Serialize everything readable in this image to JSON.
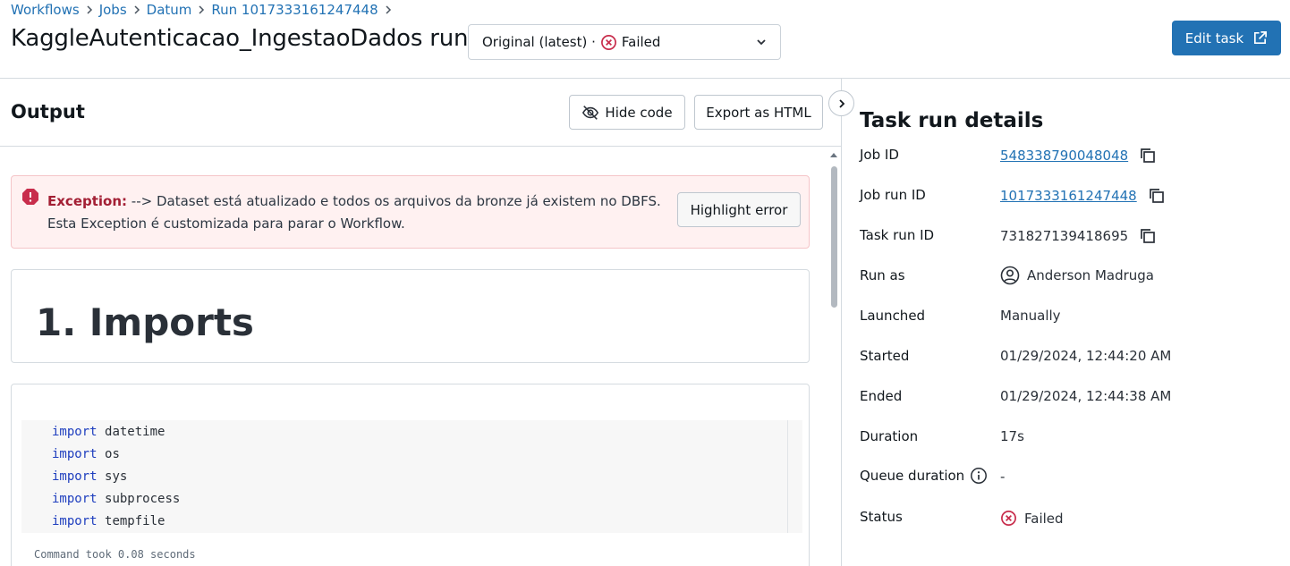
{
  "breadcrumb": {
    "items": [
      "Workflows",
      "Jobs",
      "Datum",
      "Run 1017333161247448"
    ]
  },
  "page_title": "KaggleAutenticacao_IngestaoDados run",
  "run_selector": {
    "selected": "Original (latest) ·",
    "status": "Failed"
  },
  "edit_task_label": "Edit task",
  "output": {
    "title": "Output",
    "hide_code_label": "Hide code",
    "export_label": "Export as HTML",
    "error": {
      "label": "Exception:",
      "message": " --> Dataset está atualizado e todos os arquivos da bronze já existem no DBFS. Esta Exception é customizada para parar o Workflow.",
      "highlight_label": "Highlight error"
    },
    "markdown_heading": "1. Imports",
    "code": {
      "keyword": "import",
      "modules": [
        "datetime",
        "os",
        "sys",
        "subprocess",
        "tempfile"
      ]
    },
    "command_took": "Command took 0.08 seconds"
  },
  "details": {
    "title": "Task run details",
    "job_id": {
      "label": "Job ID",
      "value": "548338790048048"
    },
    "job_run_id": {
      "label": "Job run ID",
      "value": "1017333161247448"
    },
    "task_run_id": {
      "label": "Task run ID",
      "value": "731827139418695"
    },
    "run_as": {
      "label": "Run as",
      "value": "Anderson Madruga"
    },
    "launched": {
      "label": "Launched",
      "value": "Manually"
    },
    "started": {
      "label": "Started",
      "value": "01/29/2024, 12:44:20 AM"
    },
    "ended": {
      "label": "Ended",
      "value": "01/29/2024, 12:44:38 AM"
    },
    "duration": {
      "label": "Duration",
      "value": "17s"
    },
    "queue_duration": {
      "label": "Queue duration",
      "value": "-"
    },
    "status": {
      "label": "Status",
      "value": "Failed"
    }
  },
  "colors": {
    "primary": "#2272b4",
    "error": "#c82d4c",
    "error_bg": "#fff1f1"
  }
}
